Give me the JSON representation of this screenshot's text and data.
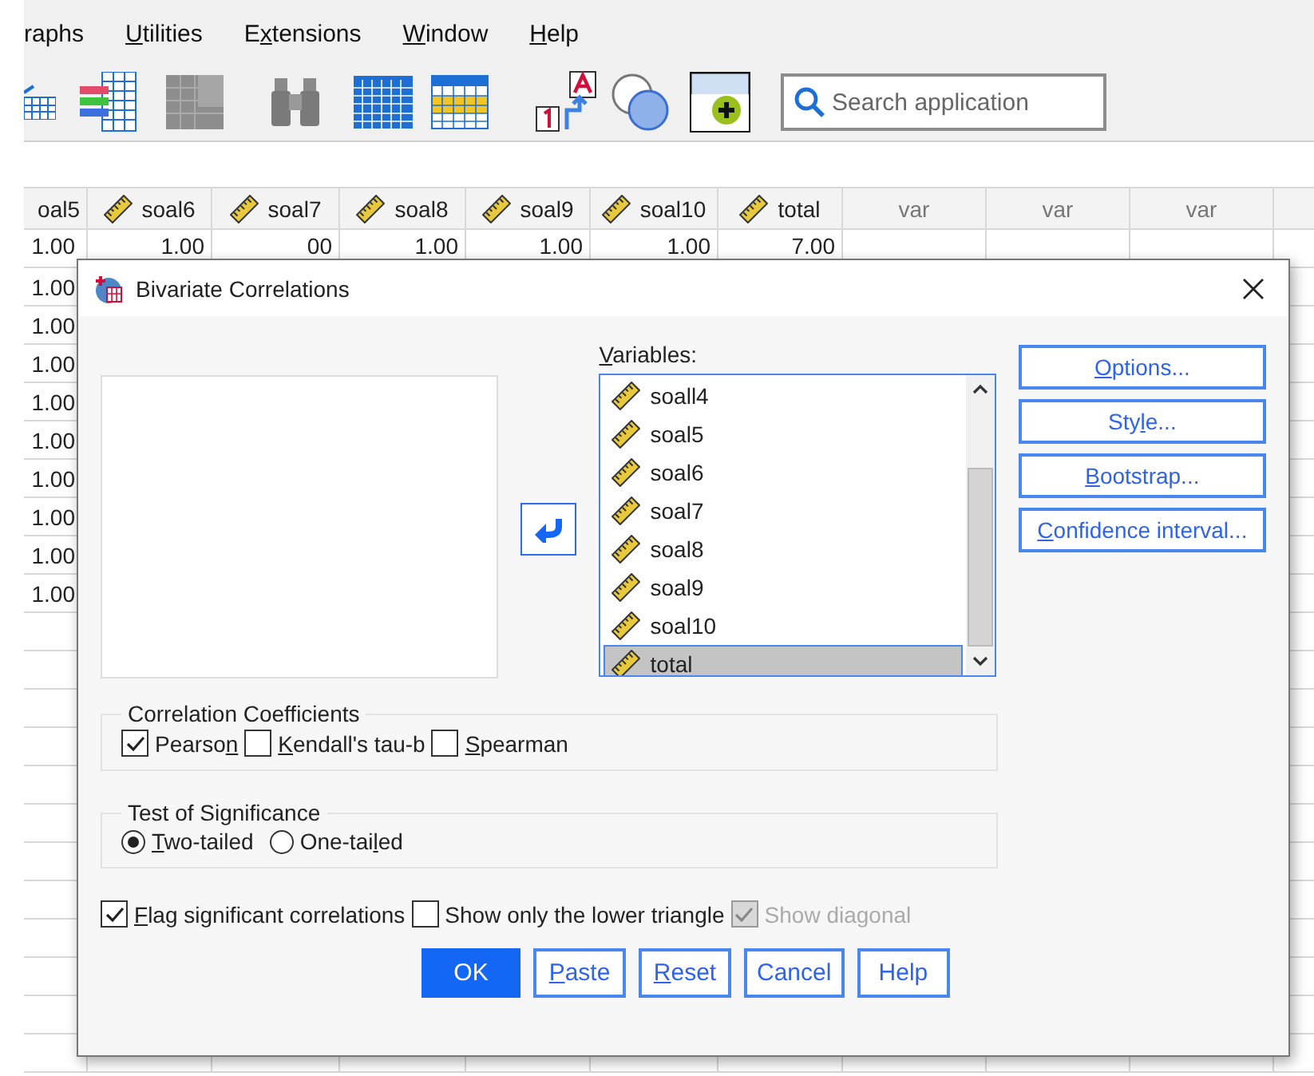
{
  "menu": [
    {
      "label": "raphs"
    },
    {
      "key": "U",
      "rest": "tilities"
    },
    {
      "text": "E",
      "key": "x",
      "rest": "tensions"
    },
    {
      "key": "W",
      "rest": "indow"
    },
    {
      "key": "H",
      "rest": "elp"
    }
  ],
  "search": {
    "placeholder": "Search application"
  },
  "grid": {
    "columns": [
      {
        "label": "oal5",
        "kind": "plain"
      },
      {
        "label": "soal6",
        "kind": "scale"
      },
      {
        "label": "soal7",
        "kind": "scale"
      },
      {
        "label": "soal8",
        "kind": "scale"
      },
      {
        "label": "soal9",
        "kind": "scale"
      },
      {
        "label": "soal10",
        "kind": "scale"
      },
      {
        "label": "total",
        "kind": "scale"
      },
      {
        "label": "var",
        "kind": "empty"
      },
      {
        "label": "var",
        "kind": "empty"
      },
      {
        "label": "var",
        "kind": "empty"
      }
    ],
    "rows": [
      [
        "1.00",
        "1.00",
        "00",
        "1.00",
        "1.00",
        "1.00",
        "7.00"
      ],
      [
        "1.00"
      ],
      [
        "1.00"
      ],
      [
        "1.00"
      ],
      [
        "1.00"
      ],
      [
        "1.00"
      ],
      [
        "1.00"
      ],
      [
        "1.00"
      ],
      [
        "1.00"
      ],
      [
        "1.00"
      ]
    ]
  },
  "dialog": {
    "title": "Bivariate Correlations",
    "variables_label": {
      "key": "V",
      "rest": "ariables:"
    },
    "variables": [
      {
        "name": "soall4",
        "selected": false
      },
      {
        "name": "soal5",
        "selected": false
      },
      {
        "name": "soal6",
        "selected": false
      },
      {
        "name": "soal7",
        "selected": false
      },
      {
        "name": "soal8",
        "selected": false
      },
      {
        "name": "soal9",
        "selected": false
      },
      {
        "name": "soal10",
        "selected": false
      },
      {
        "name": "total",
        "selected": true
      }
    ],
    "side_buttons": [
      {
        "key": "O",
        "rest": "ptions..."
      },
      {
        "text": "Sty",
        "key": "l",
        "rest": "e..."
      },
      {
        "key": "B",
        "rest": "ootstrap..."
      },
      {
        "key": "C",
        "rest": "onfidence interval..."
      }
    ],
    "coefficients": {
      "title": "Correlation Coefficients",
      "options": [
        {
          "text": "Pearso",
          "key": "n",
          "checked": true
        },
        {
          "key": "K",
          "rest": "endall's tau-b",
          "checked": false
        },
        {
          "key": "S",
          "rest": "pearman",
          "checked": false
        }
      ]
    },
    "significance": {
      "title": "Test of Significance",
      "options": [
        {
          "key": "T",
          "rest": "wo-tailed",
          "selected": true
        },
        {
          "text": "One-tai",
          "key": "l",
          "rest": "ed",
          "selected": false
        }
      ]
    },
    "flags": [
      {
        "key": "F",
        "rest": "lag significant correlations",
        "checked": true,
        "disabled": false
      },
      {
        "text": "Show only the lower trian",
        "key": "g",
        "rest": "le",
        "checked": false,
        "disabled": false
      },
      {
        "text": "Show diagonal",
        "checked": true,
        "disabled": true
      }
    ],
    "buttons": [
      {
        "text": "OK",
        "default": true
      },
      {
        "key": "P",
        "rest": "aste",
        "default": false
      },
      {
        "key": "R",
        "rest": "eset",
        "default": false
      },
      {
        "text": "Cancel",
        "default": false
      },
      {
        "text": "Help",
        "default": false
      }
    ]
  }
}
